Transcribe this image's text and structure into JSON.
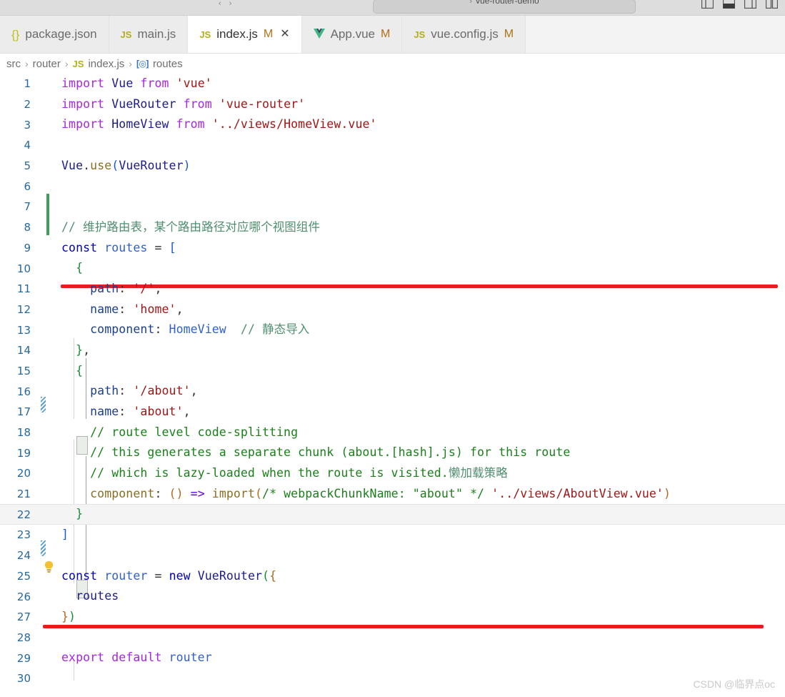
{
  "titlebar": {
    "back_forward": "‹ ›",
    "quickopen_sep": "›",
    "quickopen_text": "vue-router-demo",
    "layout_icons": [
      "layout-sidebar-left-icon",
      "layout-panel-icon",
      "layout-sidebar-right-icon",
      "layout-split-icon"
    ]
  },
  "tabs": [
    {
      "label": "package.json",
      "icon": "json-braces-icon",
      "icon_text": "{}",
      "dirty": "",
      "active": false,
      "closable": false
    },
    {
      "label": "main.js",
      "icon": "javascript-file-icon",
      "icon_text": "JS",
      "dirty": "",
      "active": false,
      "closable": false
    },
    {
      "label": "index.js",
      "icon": "javascript-file-icon",
      "icon_text": "JS",
      "dirty": "M",
      "active": true,
      "closable": true,
      "close_glyph": "✕"
    },
    {
      "label": "App.vue",
      "icon": "vue-file-icon",
      "icon_text": "V",
      "dirty": "M",
      "active": false,
      "closable": false
    },
    {
      "label": "vue.config.js",
      "icon": "javascript-file-icon",
      "icon_text": "JS",
      "dirty": "M",
      "active": false,
      "closable": false
    }
  ],
  "breadcrumb": {
    "items": [
      "src",
      "router",
      "index.js",
      "routes"
    ],
    "separator": "›",
    "file_icon_text": "JS",
    "symbol_icon_text": "[◎]"
  },
  "editor": {
    "first_line": 1,
    "last_line": 30,
    "current_line": 22,
    "lines": [
      {
        "n": 1,
        "text": "import Vue from 'vue'"
      },
      {
        "n": 2,
        "text": "import VueRouter from 'vue-router'"
      },
      {
        "n": 3,
        "text": "import HomeView from '../views/HomeView.vue'"
      },
      {
        "n": 4,
        "text": ""
      },
      {
        "n": 5,
        "text": "Vue.use(VueRouter)"
      },
      {
        "n": 6,
        "text": ""
      },
      {
        "n": 7,
        "text": ""
      },
      {
        "n": 8,
        "text": "// 维护路由表，某个路由路径对应哪个视图组件"
      },
      {
        "n": 9,
        "text": "const routes = ["
      },
      {
        "n": 10,
        "text": "  {"
      },
      {
        "n": 11,
        "text": "    path: '/',"
      },
      {
        "n": 12,
        "text": "    name: 'home',"
      },
      {
        "n": 13,
        "text": "    component: HomeView  // 静态导入"
      },
      {
        "n": 14,
        "text": "  },"
      },
      {
        "n": 15,
        "text": "  {"
      },
      {
        "n": 16,
        "text": "    path: '/about',"
      },
      {
        "n": 17,
        "text": "    name: 'about',"
      },
      {
        "n": 18,
        "text": "    // route level code-splitting"
      },
      {
        "n": 19,
        "text": "    // this generates a separate chunk (about.[hash].js) for this route"
      },
      {
        "n": 20,
        "text": "    // which is lazy-loaded when the route is visited.懒加载策略"
      },
      {
        "n": 21,
        "text": "    component: () => import(/* webpackChunkName: \"about\" */ '../views/AboutView.vue')"
      },
      {
        "n": 22,
        "text": "  }"
      },
      {
        "n": 23,
        "text": "]"
      },
      {
        "n": 24,
        "text": ""
      },
      {
        "n": 25,
        "text": "const router = new VueRouter({"
      },
      {
        "n": 26,
        "text": "  routes"
      },
      {
        "n": 27,
        "text": "})"
      },
      {
        "n": 28,
        "text": ""
      },
      {
        "n": 29,
        "text": "export default router"
      },
      {
        "n": 30,
        "text": ""
      }
    ],
    "gutter_markers": [
      {
        "name": "modified-lines-bar",
        "type": "green-bar",
        "from_line": 7,
        "to_line": 8
      },
      {
        "name": "diff-hatch-marker",
        "type": "hatch",
        "line": 13
      },
      {
        "name": "diff-hatch-marker",
        "type": "hatch",
        "line": 20
      },
      {
        "name": "quickfix-lightbulb",
        "type": "lightbulb",
        "line": 21
      }
    ],
    "annotations": [
      {
        "name": "red-underline-top",
        "line": 7,
        "color": "#e81c1c"
      },
      {
        "name": "red-underline-bottom",
        "line": 24,
        "color": "#e81c1c"
      }
    ]
  },
  "watermark": "CSDN @临界点oc",
  "colors": {
    "accent_blue": "#2f74c0",
    "js_yellow": "#b3ae1e",
    "vue_green": "#41b883",
    "dirty_orange": "#b07219",
    "annotation_red": "#e81c1c",
    "linenum_blue": "#25689e"
  }
}
